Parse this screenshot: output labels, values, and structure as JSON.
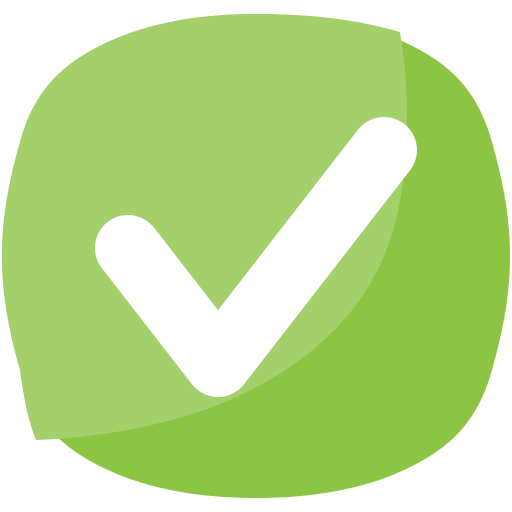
{
  "icon": {
    "name": "checkmark-icon",
    "shape": "rounded-squircle",
    "colors": {
      "base": "#8CC443",
      "highlight": "#A3D06A",
      "check": "#FFFFFF"
    }
  }
}
